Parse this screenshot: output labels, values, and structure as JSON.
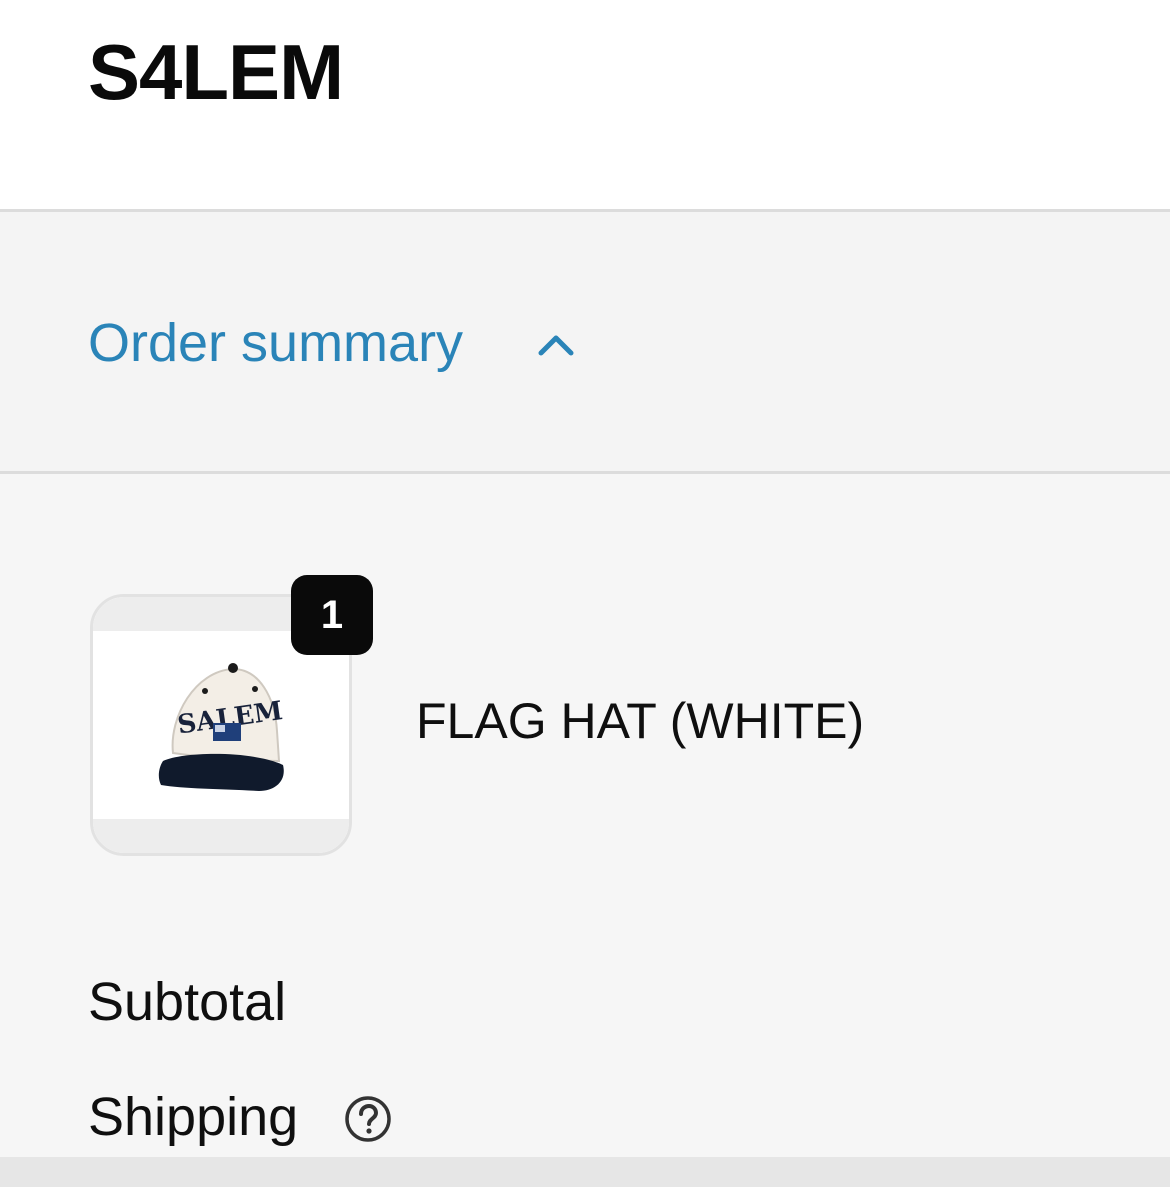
{
  "header": {
    "store_name": "S4LEM"
  },
  "order_summary": {
    "toggle_label": "Order summary",
    "toggle_icon": "chevron-up-icon",
    "accent_color": "#2a84b8"
  },
  "line_items": [
    {
      "name": "FLAG HAT (WHITE)",
      "quantity": "1",
      "thumbnail": "hat-image",
      "thumbnail_text": "SALEM"
    }
  ],
  "totals": {
    "subtotal_label": "Subtotal",
    "shipping_label": "Shipping",
    "shipping_help_icon": "question-circle-icon"
  }
}
